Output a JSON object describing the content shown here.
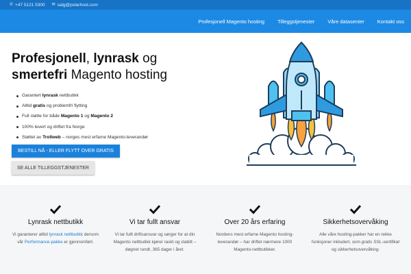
{
  "topbar": {
    "phone": "+47 5121 5300",
    "email": "salg@polarhost.com"
  },
  "nav": {
    "items": [
      {
        "label": "Profesjonell Magento hosting"
      },
      {
        "label": "Tilleggstjenester"
      },
      {
        "label": "Våre datasenter"
      },
      {
        "label": "Kontakt oss"
      }
    ]
  },
  "hero": {
    "headline": {
      "w1": "Profesjonell",
      "w2": ", ",
      "w3": "lynrask",
      "w4": " og ",
      "w5": "smertefri",
      "w6": " Magento hosting"
    },
    "bullets": [
      {
        "a": "Garantert ",
        "b": "lynrask",
        "c": " nettbutikk"
      },
      {
        "a": "Alltid ",
        "b": "gratis",
        "c": " og problemfri flytting"
      },
      {
        "a": "Full støtte for både ",
        "b": "Magento 1",
        "c": " og ",
        "d": "Magento 2"
      },
      {
        "a": "100% levert og driftet fra Norge"
      },
      {
        "a": "Støttet av ",
        "b": "Trollweb",
        "c": " – norges mest erfarne Magento-leverandør"
      }
    ],
    "primary_button": "BESTILL NÅ - ELLER FLYTT OVER GRATIS",
    "secondary_button": "SE ALLE TILLEGGSTJENESTER"
  },
  "features": [
    {
      "title": "Lynrask nettbutikk",
      "p1": "Vi garanterer alltid ",
      "l1": "lynrask nettbutikk",
      "p2": " dersom vår ",
      "l2": "Performance-pakke",
      "p3": " er gjennomført."
    },
    {
      "title": "Vi tar fullt ansvar",
      "desc": "Vi tar fullt driftsansvar og sørger for at din Magento nettbutikk kjører raskt og stabilt – døgnet rundt, 365 dager i året."
    },
    {
      "title": "Over 20 års erfaring",
      "desc": "Nordens mest erfarne Magento hosting-leverandør – har driftet nærmere 1000 Magento-nettbutikker."
    },
    {
      "title": "Sikkerhetsovervåking",
      "p1": "Alle våre hosting-pakker har en rekke funksjoner inkludert, som ",
      "i1": "gratis SSL-sertifikat",
      "p2": " og ",
      "i2": "sikkerhetsovervåking",
      "p3": "."
    }
  ],
  "colors": {
    "topbar": "#1673c6",
    "navbar": "#1c8ae4",
    "primary_button": "#1b82dc",
    "link": "#1c7bd1",
    "features_bg": "#f5f6f7"
  },
  "icons": [
    "phone-icon",
    "envelope-icon",
    "rocket-illustration",
    "checkmark-icon"
  ]
}
